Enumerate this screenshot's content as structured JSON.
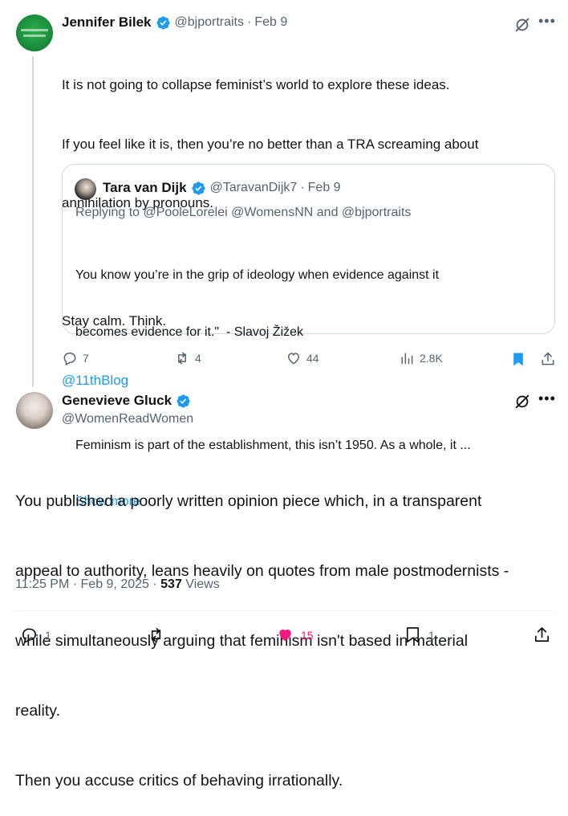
{
  "tweet1": {
    "author_name": "Jennifer Bilek",
    "author_handle": "@bjportraits",
    "time": "Feb 9",
    "lines": [
      "It is not going to collapse feminist’s world to explore these ideas.",
      "If you feel like it is, then you’re no better than a TRA screaming about",
      "annihilation by pronouns.",
      "Stay calm. Think."
    ],
    "mention": "@11thBlog",
    "quote": {
      "author_name": "Tara van Dijk",
      "author_handle": "@TaravanDijk7",
      "time": "Feb 9",
      "replying_to": "Replying to @PooleLorelei @WomensNN and @bjportraits",
      "line1": "You know you’re in the grip of ideology when evidence against it",
      "line2": "becomes evidence for it.\"  - Slavoj Žižek",
      "line3": "Feminism is part of the establishment, this isn’t 1950. As a whole, it ...",
      "show_more": "Show more"
    },
    "stats": {
      "replies": "7",
      "reposts": "4",
      "likes": "44",
      "views": "2.8K"
    }
  },
  "tweet2": {
    "author_name": "Genevieve Gluck",
    "author_handle": "@WomenReadWomen",
    "lines": [
      "You published a poorly written opinion piece which, in a transparent",
      "appeal to authority, leans heavily on quotes from male postmodernists -",
      "while simultaneously arguing that feminism isn't based in material",
      "reality.",
      "Then you accuse critics of behaving irrationally."
    ],
    "timestamp": "11:25 PM · Feb 9, 2025",
    "views_count": "537",
    "views_label": "Views",
    "stats": {
      "replies": "1",
      "likes": "15",
      "bookmarks": "1"
    }
  },
  "icons": [
    "grok-icon",
    "more-icon",
    "verified-icon",
    "reply-icon",
    "repost-icon",
    "like-icon",
    "views-icon",
    "bookmark-icon",
    "share-icon"
  ],
  "colors": {
    "accent": "#1d9bf0",
    "like": "#f91880",
    "muted": "#536471",
    "text": "#0f1419"
  }
}
